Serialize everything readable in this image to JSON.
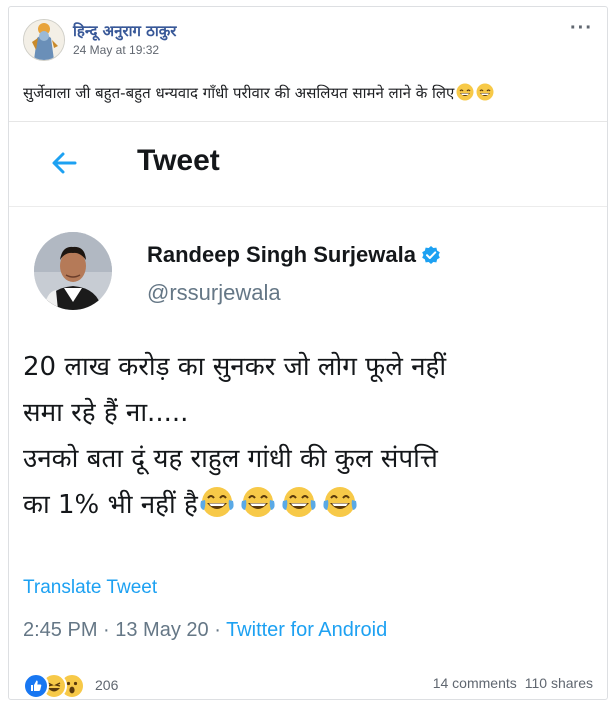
{
  "post": {
    "author": "हिन्दू अनुराग ठाकुर",
    "time": "24 May at 19:32",
    "more_label": "···",
    "text": "सुर्जेवाला जी बहुत-बहुत धन्यवाद गाँधी परीवार की असलियत सामने लाने के लिए"
  },
  "tweet": {
    "header_title": "Tweet",
    "name": "Randeep Singh Surjewala",
    "handle": "@rssurjewala",
    "lines": [
      "20 लाख करोड़ का सुनकर जो लोग फूले नहीं",
      "समा रहे हैं ना.....",
      "उनको बता दूं यह राहुल गांधी की कुल संपत्ति",
      "का 1% भी नहीं है"
    ],
    "translate": "Translate Tweet",
    "timestamp": "2:45 PM · 13 May 20 · ",
    "source": "Twitter for Android",
    "colors": {
      "link": "#1da1f2",
      "verified": "#1da1f2"
    }
  },
  "footer": {
    "reactions": [
      "like-icon",
      "haha-icon",
      "wow-icon"
    ],
    "reaction_count": "206",
    "comments": "14 comments",
    "shares": "110 shares"
  }
}
